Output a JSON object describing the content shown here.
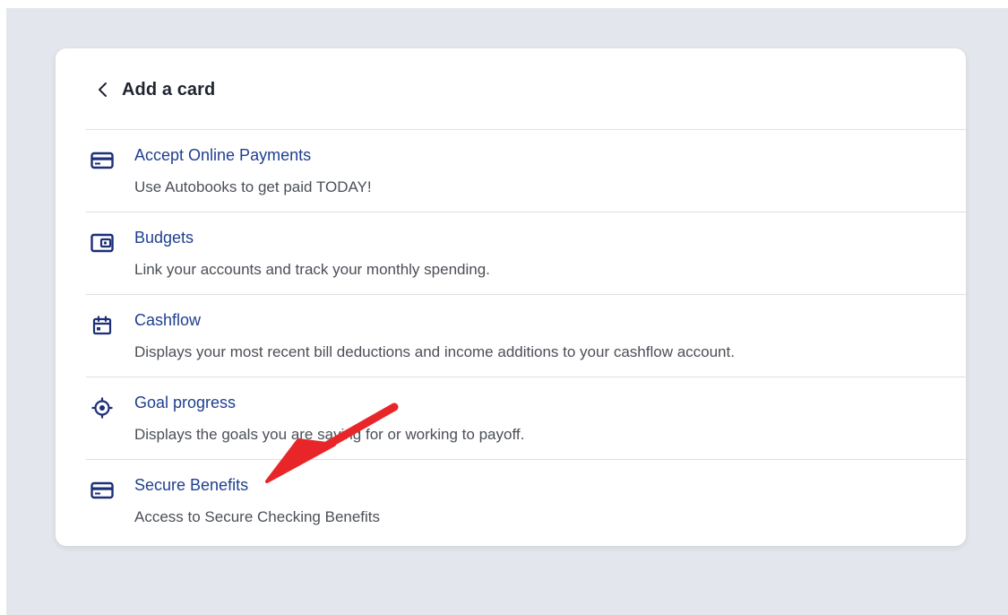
{
  "header": {
    "title": "Add a card",
    "back_icon": "chevron-left-icon"
  },
  "items": [
    {
      "icon": "credit-card-icon",
      "title": "Accept Online Payments",
      "description": "Use Autobooks to get paid TODAY!"
    },
    {
      "icon": "wallet-icon",
      "title": "Budgets",
      "description": "Link your accounts and track your monthly spending."
    },
    {
      "icon": "calendar-icon",
      "title": "Cashflow",
      "description": "Displays your most recent bill deductions and income additions to your cashflow account."
    },
    {
      "icon": "target-icon",
      "title": "Goal progress",
      "description": "Displays the goals you are saving for or working to payoff."
    },
    {
      "icon": "credit-card-icon",
      "title": "Secure Benefits",
      "description": "Access to Secure Checking Benefits"
    }
  ],
  "colors": {
    "background": "#e3e6ec",
    "card": "#ffffff",
    "title_text": "#1f2430",
    "item_title": "#1f3f8f",
    "item_description": "#4b4f57",
    "icon": "#1c2f78",
    "divider": "#dcdfe5",
    "annotation_arrow": "#e8262a"
  }
}
